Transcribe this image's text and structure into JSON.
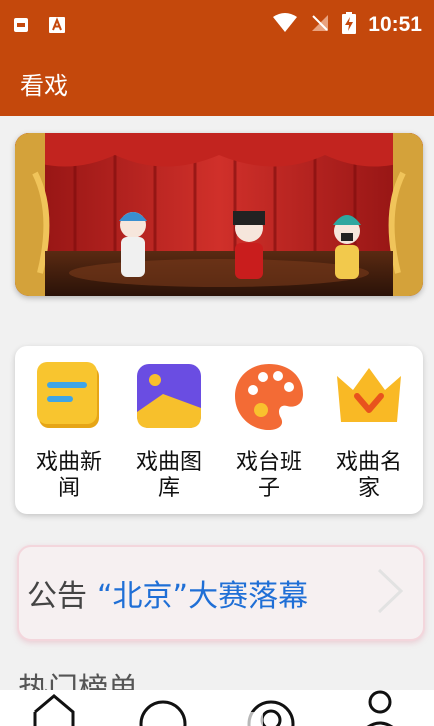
{
  "status_bar": {
    "time": "10:51",
    "icons": [
      "sim-card-icon",
      "a-badge-icon",
      "wifi-icon",
      "no-signal-icon",
      "battery-charging-icon"
    ]
  },
  "app_bar": {
    "title": "看戏"
  },
  "banner": {
    "image": "opera-stage-characters",
    "colors": {
      "curtain": "#b51f1f",
      "gold": "#d4a23a"
    }
  },
  "menu": {
    "items": [
      {
        "label": "戏曲新闻",
        "icon": "news-icon",
        "color": "#f5c02c"
      },
      {
        "label": "戏曲图库",
        "icon": "gallery-icon",
        "color": "#6b4fe0"
      },
      {
        "label": "戏台班子",
        "icon": "palette-icon",
        "color": "#f2703a"
      },
      {
        "label": "戏曲名家",
        "icon": "crown-icon",
        "color": "#f5b52a"
      }
    ]
  },
  "notice": {
    "label": "公告",
    "text": "“北京”大赛落幕"
  },
  "sections": {
    "hot_list": "热门榜单"
  },
  "bottom_nav": {
    "items": [
      {
        "icon": "home-icon"
      },
      {
        "icon": "search-icon"
      },
      {
        "icon": "discover-icon"
      },
      {
        "icon": "profile-icon"
      }
    ]
  },
  "colors": {
    "primary": "#c4480c",
    "link": "#1f6fd6"
  }
}
